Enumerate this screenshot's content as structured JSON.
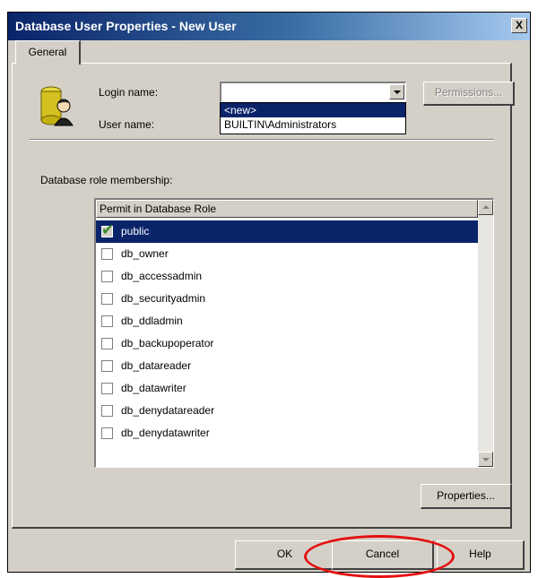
{
  "window": {
    "title": "Database User Properties - New User",
    "close_label": "X"
  },
  "tabs": [
    {
      "label": "General",
      "selected": true
    }
  ],
  "form": {
    "login_name_label": "Login name:",
    "user_name_label": "User name:",
    "login_name_value": "",
    "permissions_button": "Permissions...",
    "permissions_enabled": false,
    "dropdown_options": [
      "<new>",
      "BUILTIN\\Administrators"
    ],
    "dropdown_selected": "<new>"
  },
  "roles": {
    "section_label": "Database role membership:",
    "column_header": "Permit in Database Role",
    "items": [
      {
        "label": "public",
        "checked": true,
        "selected": true
      },
      {
        "label": "db_owner",
        "checked": false,
        "selected": false
      },
      {
        "label": "db_accessadmin",
        "checked": false,
        "selected": false
      },
      {
        "label": "db_securityadmin",
        "checked": false,
        "selected": false
      },
      {
        "label": "db_ddladmin",
        "checked": false,
        "selected": false
      },
      {
        "label": "db_backupoperator",
        "checked": false,
        "selected": false
      },
      {
        "label": "db_datareader",
        "checked": false,
        "selected": false
      },
      {
        "label": "db_datawriter",
        "checked": false,
        "selected": false
      },
      {
        "label": "db_denydatareader",
        "checked": false,
        "selected": false
      },
      {
        "label": "db_denydatawriter",
        "checked": false,
        "selected": false
      }
    ],
    "properties_button": "Properties..."
  },
  "footer": {
    "ok_button": "OK",
    "cancel_button": "Cancel",
    "help_button": "Help"
  },
  "colors": {
    "selection": "#0a246a",
    "highlight_ellipse": "#e41010",
    "check_mark": "#3a8a2a"
  }
}
